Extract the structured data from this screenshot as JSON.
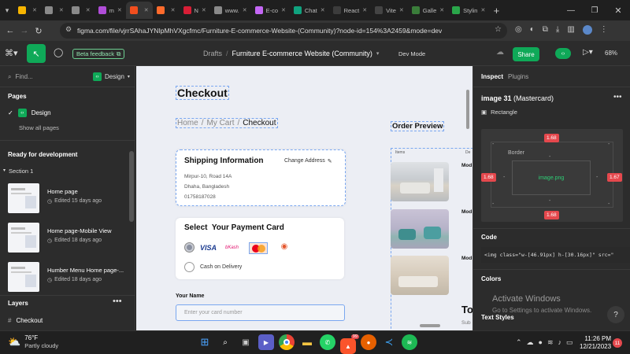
{
  "browser": {
    "tabs": [
      {
        "label": "",
        "color": "#f7b500"
      },
      {
        "label": "",
        "color": "#8a8a8a"
      },
      {
        "label": "",
        "color": "#8a8a8a"
      },
      {
        "label": "m",
        "color": "#b04dd8"
      },
      {
        "label": "",
        "color": "#f24e1e",
        "active": true
      },
      {
        "label": "",
        "color": "#ff6b2c"
      },
      {
        "label": "N",
        "color": "#d81e36"
      },
      {
        "label": "www.",
        "color": "#8a8a8a"
      },
      {
        "label": "E-co",
        "color": "#c467f5"
      },
      {
        "label": "Chat",
        "color": "#10a37f"
      },
      {
        "label": "React",
        "color": "#3c3c3c"
      },
      {
        "label": "Vite",
        "color": "#444"
      },
      {
        "label": "Galle",
        "color": "#3a7d3a"
      },
      {
        "label": "Stylin",
        "color": "#2aa64a"
      }
    ],
    "new_tab": "+",
    "url": "figma.com/file/vjrrSAhaJYNIpMhVXgcfmc/Furniture-E-commerce-Website-(Community)?node-id=154%3A2459&mode=dev"
  },
  "figma": {
    "beta_feedback": "Beta feedback",
    "breadcrumb_drafts": "Drafts",
    "breadcrumb_sep": "/",
    "file_name": "Furniture E-commerce Website (Community)",
    "mode": "Dev Mode",
    "share": "Share",
    "zoom": "68%"
  },
  "left_panel": {
    "search": "Find...",
    "design_badge": "Design",
    "pages_title": "Pages",
    "page_design": "Design",
    "show_all": "Show all pages",
    "ready_title": "Ready for development",
    "section": "Section 1",
    "frames": [
      {
        "name": "Home page",
        "edited": "Edited 15 days ago"
      },
      {
        "name": "Home page-Mobile View",
        "edited": "Edited 18 days ago"
      },
      {
        "name": "Humber Menu Home page-...",
        "edited": "Edited 18 days ago"
      }
    ],
    "layers_title": "Layers",
    "layer_checkout": "Checkout"
  },
  "canvas": {
    "title": "Checkout",
    "crumb_home": "Home",
    "crumb_cart": "My Cart",
    "crumb_sep": "/",
    "crumb_current": "Checkout",
    "shipping_title": "Shipping Information",
    "change_address": "Change Address",
    "address_1": "Mirpur-10, Road 14A",
    "address_2": "Dhaha, Bangladesh",
    "phone": "01758187028",
    "payment_title": "Select  Your Payment Card",
    "cod": "Cash on Delivery",
    "your_name": "Your Name",
    "card_placeholder": "Enter your card number",
    "order_preview": "Order Preview",
    "items_label": "Items",
    "model_short": "Mod",
    "total_short": "To",
    "sub_short": "Sub"
  },
  "right_panel": {
    "tab_inspect": "Inspect",
    "tab_plugins": "Plugins",
    "element": "image 31",
    "element_note": "(Mastercard)",
    "type": "Rectangle",
    "border_label": "Border",
    "margin_top": "1.68",
    "margin_left": "1.68",
    "margin_right": "1.67",
    "margin_bottom": "1.68",
    "inner": "image.png",
    "dash": "-",
    "code_title": "Code",
    "code": "<img class=\"w-[46.91px] h-[30.16px]\" src=\"",
    "colors_title": "Colors",
    "activate": "Activate Windows",
    "activate_sub": "Go to Settings to activate Windows.",
    "text_styles": "Text Styles",
    "help": "?"
  },
  "taskbar": {
    "temp": "76°F",
    "weather": "Partly cloudy",
    "time": "11:26 PM",
    "date": "12/21/2023",
    "notif": "11",
    "badge": "99"
  }
}
